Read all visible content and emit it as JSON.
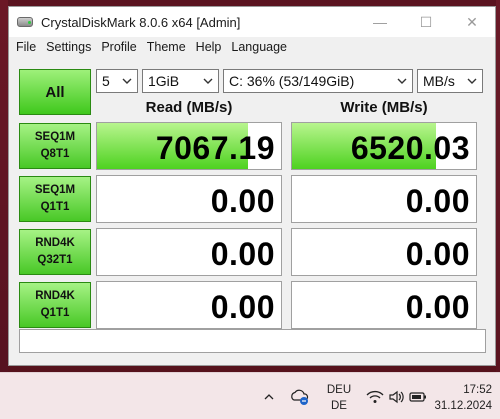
{
  "window": {
    "title": "CrystalDiskMark 8.0.6 x64 [Admin]",
    "controls": {
      "minimize": "—",
      "maximize": "☐",
      "close": "✕"
    }
  },
  "menu": [
    "File",
    "Settings",
    "Profile",
    "Theme",
    "Help",
    "Language"
  ],
  "toolbar": {
    "all_label": "All",
    "count_value": "5",
    "size_value": "1GiB",
    "drive_value": "C: 36% (53/149GiB)",
    "unit_value": "MB/s"
  },
  "headers": {
    "read": "Read (MB/s)",
    "write": "Write (MB/s)"
  },
  "tests": [
    {
      "line1": "SEQ1M",
      "line2": "Q8T1",
      "read": "7067.19",
      "write": "6520.03",
      "read_fill": 0.82,
      "write_fill": 0.78
    },
    {
      "line1": "SEQ1M",
      "line2": "Q1T1",
      "read": "0.00",
      "write": "0.00",
      "read_fill": 0,
      "write_fill": 0
    },
    {
      "line1": "RND4K",
      "line2": "Q32T1",
      "read": "0.00",
      "write": "0.00",
      "read_fill": 0,
      "write_fill": 0
    },
    {
      "line1": "RND4K",
      "line2": "Q1T1",
      "read": "0.00",
      "write": "0.00",
      "read_fill": 0,
      "write_fill": 0
    }
  ],
  "comment": "",
  "taskbar": {
    "lang_top": "DEU",
    "lang_bottom": "DE",
    "time": "17:52",
    "date": "31.12.2024",
    "icons": [
      "chevron-up-icon",
      "onedrive-sync-icon",
      "wifi-icon",
      "speaker-icon",
      "battery-icon"
    ]
  },
  "colors": {
    "accent_green": "#3fc81c",
    "bar_green": "#4ed220"
  }
}
